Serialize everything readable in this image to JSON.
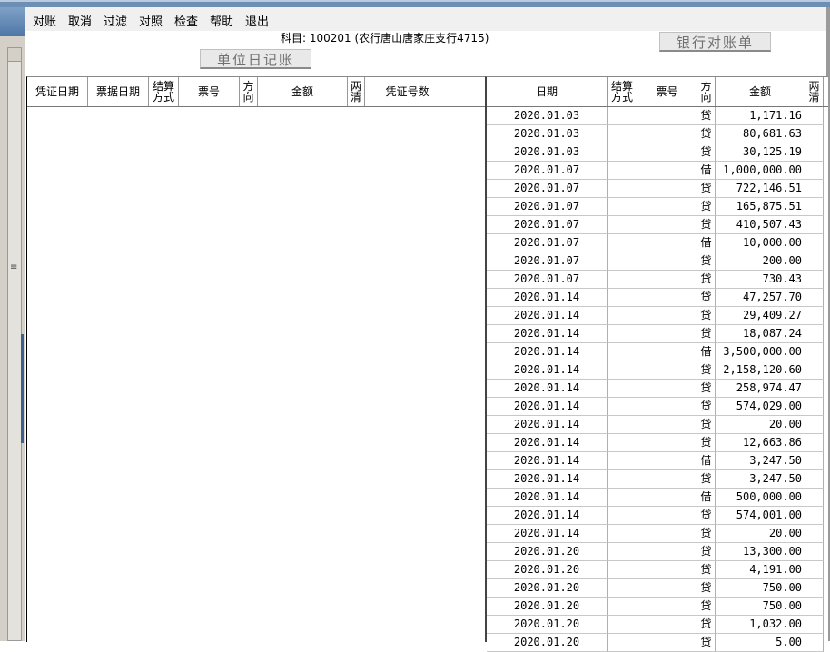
{
  "menu": [
    "对账",
    "取消",
    "过滤",
    "对照",
    "检查",
    "帮助",
    "退出"
  ],
  "subject": "科目: 100201 (农行唐山唐家庄支行4715)",
  "buttons": {
    "unit_journal": "单位日记账",
    "bank_statement": "银行对账单"
  },
  "left_columns": [
    "凭证日期",
    "票据日期",
    "结算方式",
    "票号",
    "方向",
    "金额",
    "两清",
    "凭证号数"
  ],
  "right_columns": [
    "日期",
    "结算方式",
    "票号",
    "方向",
    "金额",
    "两清"
  ],
  "right_rows": [
    {
      "date": "2020.01.03",
      "dir": "贷",
      "amount": "1,171.16"
    },
    {
      "date": "2020.01.03",
      "dir": "贷",
      "amount": "80,681.63"
    },
    {
      "date": "2020.01.03",
      "dir": "贷",
      "amount": "30,125.19"
    },
    {
      "date": "2020.01.07",
      "dir": "借",
      "amount": "1,000,000.00"
    },
    {
      "date": "2020.01.07",
      "dir": "贷",
      "amount": "722,146.51"
    },
    {
      "date": "2020.01.07",
      "dir": "贷",
      "amount": "165,875.51"
    },
    {
      "date": "2020.01.07",
      "dir": "贷",
      "amount": "410,507.43"
    },
    {
      "date": "2020.01.07",
      "dir": "借",
      "amount": "10,000.00"
    },
    {
      "date": "2020.01.07",
      "dir": "贷",
      "amount": "200.00"
    },
    {
      "date": "2020.01.07",
      "dir": "贷",
      "amount": "730.43"
    },
    {
      "date": "2020.01.14",
      "dir": "贷",
      "amount": "47,257.70"
    },
    {
      "date": "2020.01.14",
      "dir": "贷",
      "amount": "29,409.27"
    },
    {
      "date": "2020.01.14",
      "dir": "贷",
      "amount": "18,087.24"
    },
    {
      "date": "2020.01.14",
      "dir": "借",
      "amount": "3,500,000.00"
    },
    {
      "date": "2020.01.14",
      "dir": "贷",
      "amount": "2,158,120.60"
    },
    {
      "date": "2020.01.14",
      "dir": "贷",
      "amount": "258,974.47"
    },
    {
      "date": "2020.01.14",
      "dir": "贷",
      "amount": "574,029.00"
    },
    {
      "date": "2020.01.14",
      "dir": "贷",
      "amount": "20.00"
    },
    {
      "date": "2020.01.14",
      "dir": "贷",
      "amount": "12,663.86"
    },
    {
      "date": "2020.01.14",
      "dir": "借",
      "amount": "3,247.50"
    },
    {
      "date": "2020.01.14",
      "dir": "贷",
      "amount": "3,247.50"
    },
    {
      "date": "2020.01.14",
      "dir": "借",
      "amount": "500,000.00"
    },
    {
      "date": "2020.01.14",
      "dir": "贷",
      "amount": "574,001.00"
    },
    {
      "date": "2020.01.14",
      "dir": "贷",
      "amount": "20.00"
    },
    {
      "date": "2020.01.20",
      "dir": "贷",
      "amount": "13,300.00"
    },
    {
      "date": "2020.01.20",
      "dir": "贷",
      "amount": "4,191.00"
    },
    {
      "date": "2020.01.20",
      "dir": "贷",
      "amount": "750.00"
    },
    {
      "date": "2020.01.20",
      "dir": "贷",
      "amount": "750.00"
    },
    {
      "date": "2020.01.20",
      "dir": "贷",
      "amount": "1,032.00"
    },
    {
      "date": "2020.01.20",
      "dir": "贷",
      "amount": "5.00"
    }
  ]
}
